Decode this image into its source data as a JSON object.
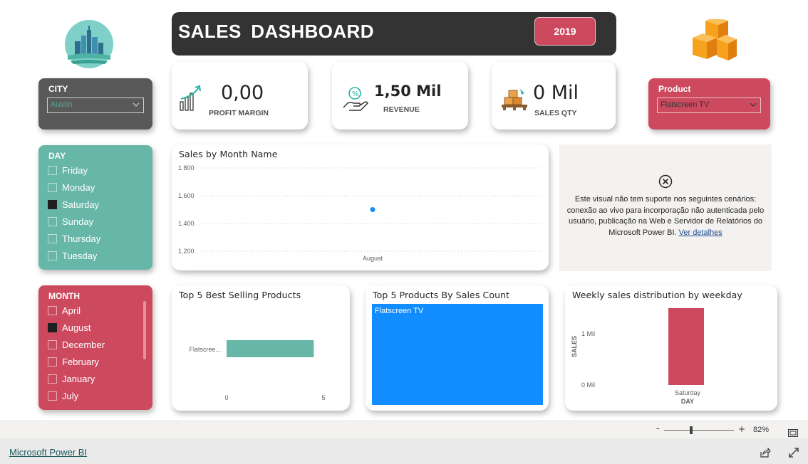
{
  "header": {
    "title": "SALES  DASHBOARD",
    "year": "2019"
  },
  "city_slicer": {
    "label": "CITY",
    "value": "Austin"
  },
  "product_slicer": {
    "label": "Product",
    "value": "Flatscreen TV"
  },
  "kpis": {
    "profit_margin": {
      "value": "0,00",
      "label": "PROFIT MARGIN"
    },
    "revenue": {
      "value": "1,50 Mil",
      "label": "REVENUE"
    },
    "sales_qty": {
      "value": "0 Mil",
      "label": "SALES QTY"
    }
  },
  "day_slicer": {
    "label": "DAY",
    "items": [
      {
        "label": "Friday",
        "checked": false
      },
      {
        "label": "Monday",
        "checked": false
      },
      {
        "label": "Saturday",
        "checked": true
      },
      {
        "label": "Sunday",
        "checked": false
      },
      {
        "label": "Thursday",
        "checked": false
      },
      {
        "label": "Tuesday",
        "checked": false
      }
    ]
  },
  "month_slicer": {
    "label": "MONTH",
    "items": [
      {
        "label": "April",
        "checked": false
      },
      {
        "label": "August",
        "checked": true
      },
      {
        "label": "December",
        "checked": false
      },
      {
        "label": "February",
        "checked": false
      },
      {
        "label": "January",
        "checked": false
      },
      {
        "label": "July",
        "checked": false
      }
    ]
  },
  "unsupported_visual": {
    "message": "Este visual não tem suporte nos seguintes cenários: conexão ao vivo para incorporação não autenticada pelo usuário, publicação na Web e Servidor de Relatórios do Microsoft Power BI.",
    "link": "Ver detalhes"
  },
  "colors": {
    "teal": "#66b7a8",
    "crimson": "#cd4a5e",
    "dark": "#333333",
    "gray": "#595959",
    "blue": "#118dff"
  },
  "icons": {
    "logo": "city-logo-icon",
    "boxes": "boxes-icon",
    "profit": "growth-chart-icon",
    "revenue": "money-hand-icon",
    "qty": "pallet-boxes-icon",
    "error": "error-circle-icon"
  },
  "footer": {
    "link": "Microsoft Power BI",
    "zoom": "82%",
    "zoom_minus": "-",
    "zoom_plus": "+"
  },
  "chart_data": [
    {
      "type": "scatter",
      "title": "Sales by Month Name",
      "categories": [
        "August"
      ],
      "values": [
        1500
      ],
      "ytick_labels": [
        "1.800",
        "1.600",
        "1.400",
        "1.200"
      ],
      "ylim": [
        1200,
        1800
      ],
      "grid": true
    },
    {
      "type": "bar",
      "orientation": "horizontal",
      "title": "Top 5 Best Selling Products",
      "categories": [
        "Flatscree..."
      ],
      "values": [
        4.5
      ],
      "xtick_labels": [
        "0",
        "5"
      ],
      "xlim": [
        0,
        5
      ]
    },
    {
      "type": "heatmap",
      "title": "Top 5 Products By Sales Count",
      "categories": [
        "Flatscreen TV"
      ],
      "values": [
        1
      ]
    },
    {
      "type": "bar",
      "title": "Weekly sales distribution by weekday",
      "categories": [
        "Saturday"
      ],
      "values": [
        1500
      ],
      "xlabel": "DAY",
      "ylabel": "SALES",
      "ytick_labels": [
        "1 Mil",
        "0 Mil"
      ]
    }
  ]
}
